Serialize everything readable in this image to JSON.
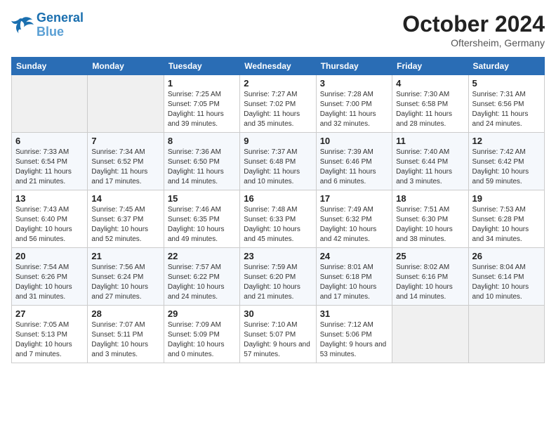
{
  "logo": {
    "name1": "General",
    "name2": "Blue"
  },
  "title": "October 2024",
  "location": "Oftersheim, Germany",
  "weekdays": [
    "Sunday",
    "Monday",
    "Tuesday",
    "Wednesday",
    "Thursday",
    "Friday",
    "Saturday"
  ],
  "weeks": [
    [
      {
        "day": "",
        "info": ""
      },
      {
        "day": "",
        "info": ""
      },
      {
        "day": "1",
        "info": "Sunrise: 7:25 AM\nSunset: 7:05 PM\nDaylight: 11 hours and 39 minutes."
      },
      {
        "day": "2",
        "info": "Sunrise: 7:27 AM\nSunset: 7:02 PM\nDaylight: 11 hours and 35 minutes."
      },
      {
        "day": "3",
        "info": "Sunrise: 7:28 AM\nSunset: 7:00 PM\nDaylight: 11 hours and 32 minutes."
      },
      {
        "day": "4",
        "info": "Sunrise: 7:30 AM\nSunset: 6:58 PM\nDaylight: 11 hours and 28 minutes."
      },
      {
        "day": "5",
        "info": "Sunrise: 7:31 AM\nSunset: 6:56 PM\nDaylight: 11 hours and 24 minutes."
      }
    ],
    [
      {
        "day": "6",
        "info": "Sunrise: 7:33 AM\nSunset: 6:54 PM\nDaylight: 11 hours and 21 minutes."
      },
      {
        "day": "7",
        "info": "Sunrise: 7:34 AM\nSunset: 6:52 PM\nDaylight: 11 hours and 17 minutes."
      },
      {
        "day": "8",
        "info": "Sunrise: 7:36 AM\nSunset: 6:50 PM\nDaylight: 11 hours and 14 minutes."
      },
      {
        "day": "9",
        "info": "Sunrise: 7:37 AM\nSunset: 6:48 PM\nDaylight: 11 hours and 10 minutes."
      },
      {
        "day": "10",
        "info": "Sunrise: 7:39 AM\nSunset: 6:46 PM\nDaylight: 11 hours and 6 minutes."
      },
      {
        "day": "11",
        "info": "Sunrise: 7:40 AM\nSunset: 6:44 PM\nDaylight: 11 hours and 3 minutes."
      },
      {
        "day": "12",
        "info": "Sunrise: 7:42 AM\nSunset: 6:42 PM\nDaylight: 10 hours and 59 minutes."
      }
    ],
    [
      {
        "day": "13",
        "info": "Sunrise: 7:43 AM\nSunset: 6:40 PM\nDaylight: 10 hours and 56 minutes."
      },
      {
        "day": "14",
        "info": "Sunrise: 7:45 AM\nSunset: 6:37 PM\nDaylight: 10 hours and 52 minutes."
      },
      {
        "day": "15",
        "info": "Sunrise: 7:46 AM\nSunset: 6:35 PM\nDaylight: 10 hours and 49 minutes."
      },
      {
        "day": "16",
        "info": "Sunrise: 7:48 AM\nSunset: 6:33 PM\nDaylight: 10 hours and 45 minutes."
      },
      {
        "day": "17",
        "info": "Sunrise: 7:49 AM\nSunset: 6:32 PM\nDaylight: 10 hours and 42 minutes."
      },
      {
        "day": "18",
        "info": "Sunrise: 7:51 AM\nSunset: 6:30 PM\nDaylight: 10 hours and 38 minutes."
      },
      {
        "day": "19",
        "info": "Sunrise: 7:53 AM\nSunset: 6:28 PM\nDaylight: 10 hours and 34 minutes."
      }
    ],
    [
      {
        "day": "20",
        "info": "Sunrise: 7:54 AM\nSunset: 6:26 PM\nDaylight: 10 hours and 31 minutes."
      },
      {
        "day": "21",
        "info": "Sunrise: 7:56 AM\nSunset: 6:24 PM\nDaylight: 10 hours and 27 minutes."
      },
      {
        "day": "22",
        "info": "Sunrise: 7:57 AM\nSunset: 6:22 PM\nDaylight: 10 hours and 24 minutes."
      },
      {
        "day": "23",
        "info": "Sunrise: 7:59 AM\nSunset: 6:20 PM\nDaylight: 10 hours and 21 minutes."
      },
      {
        "day": "24",
        "info": "Sunrise: 8:01 AM\nSunset: 6:18 PM\nDaylight: 10 hours and 17 minutes."
      },
      {
        "day": "25",
        "info": "Sunrise: 8:02 AM\nSunset: 6:16 PM\nDaylight: 10 hours and 14 minutes."
      },
      {
        "day": "26",
        "info": "Sunrise: 8:04 AM\nSunset: 6:14 PM\nDaylight: 10 hours and 10 minutes."
      }
    ],
    [
      {
        "day": "27",
        "info": "Sunrise: 7:05 AM\nSunset: 5:13 PM\nDaylight: 10 hours and 7 minutes."
      },
      {
        "day": "28",
        "info": "Sunrise: 7:07 AM\nSunset: 5:11 PM\nDaylight: 10 hours and 3 minutes."
      },
      {
        "day": "29",
        "info": "Sunrise: 7:09 AM\nSunset: 5:09 PM\nDaylight: 10 hours and 0 minutes."
      },
      {
        "day": "30",
        "info": "Sunrise: 7:10 AM\nSunset: 5:07 PM\nDaylight: 9 hours and 57 minutes."
      },
      {
        "day": "31",
        "info": "Sunrise: 7:12 AM\nSunset: 5:06 PM\nDaylight: 9 hours and 53 minutes."
      },
      {
        "day": "",
        "info": ""
      },
      {
        "day": "",
        "info": ""
      }
    ]
  ]
}
